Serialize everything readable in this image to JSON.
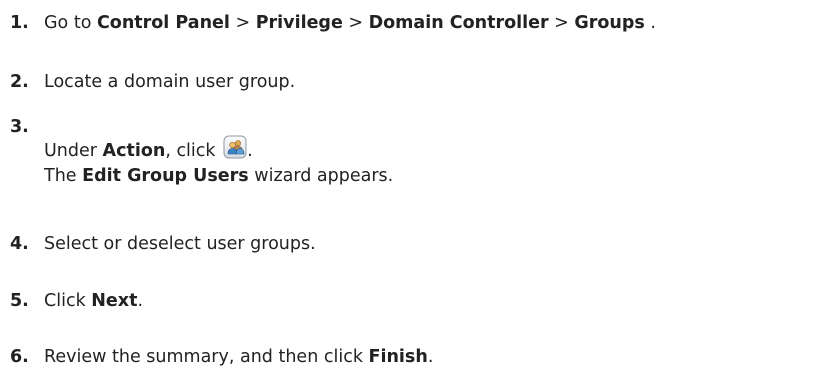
{
  "steps": [
    {
      "num": "1.",
      "parts": {
        "a": "Go to ",
        "b": "Control Panel",
        "c": " > ",
        "d": "Privilege",
        "e": " > ",
        "f": "Domain Controller",
        "g": " > ",
        "h": "Groups",
        "i": " ."
      }
    },
    {
      "num": "2.",
      "parts": {
        "a": "Locate a domain user group."
      }
    },
    {
      "num": "3.",
      "parts": {
        "a": "Under ",
        "b": "Action",
        "c": ", click ",
        "icon": "edit-group-users-icon",
        "d": ".",
        "e": "The ",
        "f": "Edit Group Users",
        "g": " wizard appears."
      }
    },
    {
      "num": "4.",
      "parts": {
        "a": "Select or deselect user groups."
      }
    },
    {
      "num": "5.",
      "parts": {
        "a": "Click ",
        "b": "Next",
        "c": "."
      }
    },
    {
      "num": "6.",
      "parts": {
        "a": "Review the summary, and then click ",
        "b": "Finish",
        "c": "."
      }
    }
  ]
}
